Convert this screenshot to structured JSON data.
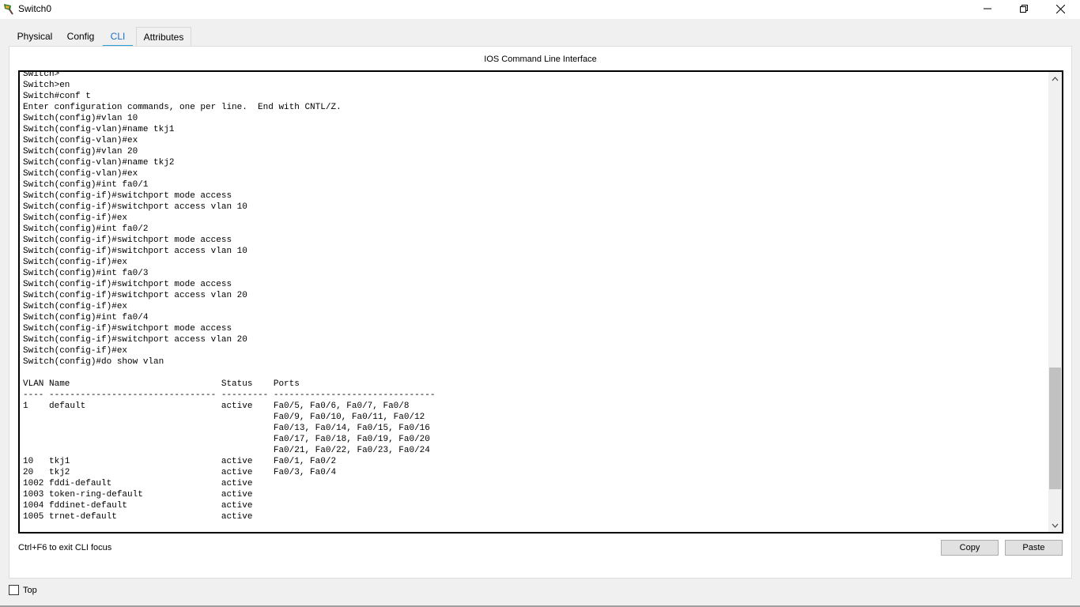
{
  "window": {
    "title": "Switch0"
  },
  "tabs": [
    {
      "label": "Physical"
    },
    {
      "label": "Config"
    },
    {
      "label": "CLI"
    },
    {
      "label": "Attributes"
    }
  ],
  "active_tab": "CLI",
  "cli": {
    "heading": "IOS Command Line Interface",
    "output": "Switch>\nSwitch>en\nSwitch#conf t\nEnter configuration commands, one per line.  End with CNTL/Z.\nSwitch(config)#vlan 10\nSwitch(config-vlan)#name tkj1\nSwitch(config-vlan)#ex\nSwitch(config)#vlan 20\nSwitch(config-vlan)#name tkj2\nSwitch(config-vlan)#ex\nSwitch(config)#int fa0/1\nSwitch(config-if)#switchport mode access\nSwitch(config-if)#switchport access vlan 10\nSwitch(config-if)#ex\nSwitch(config)#int fa0/2\nSwitch(config-if)#switchport mode access\nSwitch(config-if)#switchport access vlan 10\nSwitch(config-if)#ex\nSwitch(config)#int fa0/3\nSwitch(config-if)#switchport mode access\nSwitch(config-if)#switchport access vlan 20\nSwitch(config-if)#ex\nSwitch(config)#int fa0/4\nSwitch(config-if)#switchport mode access\nSwitch(config-if)#switchport access vlan 20\nSwitch(config-if)#ex\nSwitch(config)#do show vlan\n\nVLAN Name                             Status    Ports\n---- -------------------------------- --------- -------------------------------\n1    default                          active    Fa0/5, Fa0/6, Fa0/7, Fa0/8\n                                                Fa0/9, Fa0/10, Fa0/11, Fa0/12\n                                                Fa0/13, Fa0/14, Fa0/15, Fa0/16\n                                                Fa0/17, Fa0/18, Fa0/19, Fa0/20\n                                                Fa0/21, Fa0/22, Fa0/23, Fa0/24\n10   tkj1                             active    Fa0/1, Fa0/2\n20   tkj2                             active    Fa0/3, Fa0/4\n1002 fddi-default                     active    \n1003 token-ring-default               active    \n1004 fddinet-default                  active    \n1005 trnet-default                    active    "
  },
  "footer": {
    "hint": "Ctrl+F6 to exit CLI focus",
    "copy_label": "Copy",
    "paste_label": "Paste",
    "top_label": "Top"
  },
  "colors": {
    "active_tab_text": "#1a6fc7",
    "active_tab_underline": "#2aa0d6"
  },
  "icons": {
    "app": "packet-tracer-switch-icon",
    "minimize": "minimize-icon",
    "maximize": "restore-icon",
    "close": "close-icon"
  }
}
